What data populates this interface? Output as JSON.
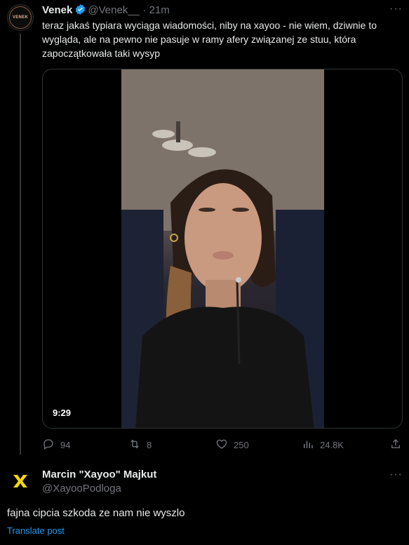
{
  "tweet": {
    "author_name": "Venek",
    "author_handle": "@Venek__",
    "time": "· 21m",
    "avatar_text": "VENEK",
    "text": "teraz jakaś typiara wyciąga wiadomości, niby na xayoo - nie wiem, dziwnie to wygląda, ale na pewno nie pasuje w ramy afery związanej ze stuu, która zapoczątkowała taki wysyp",
    "video_duration": "9:29",
    "replies": "94",
    "reposts": "8",
    "likes": "250",
    "views": "24.8K",
    "more": "···"
  },
  "reply": {
    "author_name": "Marcin \"Xayoo\" Majkut",
    "author_handle": "@XayooPodloga",
    "more": "···",
    "text": "fajna cipcia szkoda ze nam nie wyszlo",
    "translate_label": "Translate post"
  },
  "colors": {
    "verified": "#1d9bf0",
    "link": "#1d9bf0",
    "muted": "#71767b",
    "xayoo_logo": "#f5d60a"
  }
}
